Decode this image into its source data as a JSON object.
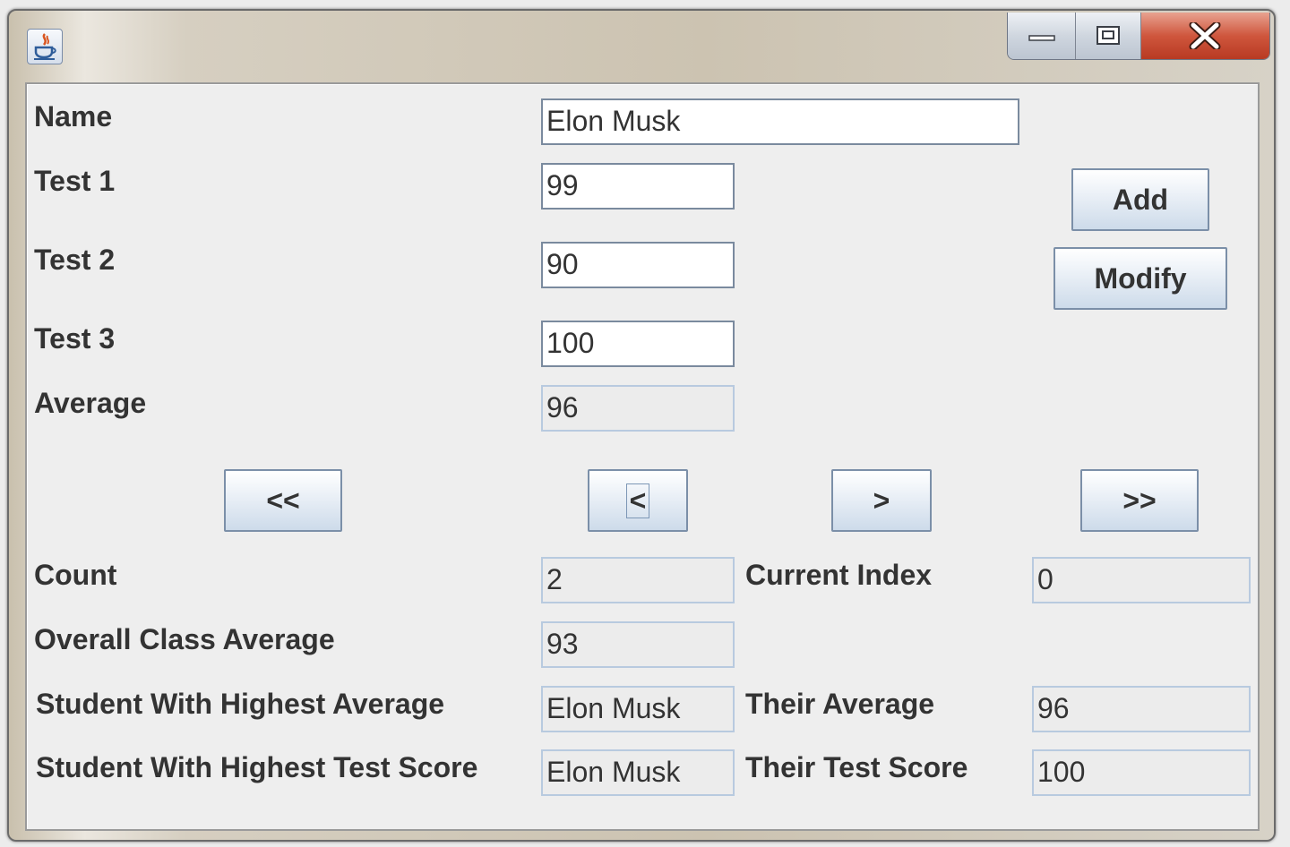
{
  "window": {
    "title": "",
    "icon": "java-coffee-cup-icon",
    "controls": {
      "minimize": "minimize-icon",
      "maximize": "maximize-icon",
      "close": "close-icon"
    }
  },
  "form": {
    "name_label": "Name",
    "name_value": "Elon Musk",
    "test1_label": "Test 1",
    "test1_value": "99",
    "test2_label": "Test 2",
    "test2_value": "90",
    "test3_label": "Test 3",
    "test3_value": "100",
    "average_label": "Average",
    "average_value": "96"
  },
  "actions": {
    "add": "Add",
    "modify": "Modify"
  },
  "nav": {
    "first": "<<",
    "prev": "<",
    "next": ">",
    "last": ">>"
  },
  "stats": {
    "count_label": "Count",
    "count_value": "2",
    "current_index_label": "Current Index",
    "current_index_value": "0",
    "class_avg_label": "Overall Class Average",
    "class_avg_value": "93",
    "highest_avg_label": "Student With Highest Average",
    "highest_avg_value": "Elon Musk",
    "their_avg_label": "Their Average",
    "their_avg_value": "96",
    "highest_test_label": "Student With Highest Test Score",
    "highest_test_value": "Elon Musk",
    "their_test_label": "Their Test Score",
    "their_test_value": "100"
  },
  "colors": {
    "field_border": "#7a8a9e",
    "readonly_border": "#b8cadf",
    "button_gradient_bottom": "#cddbea",
    "close_button": "#cf563d"
  }
}
